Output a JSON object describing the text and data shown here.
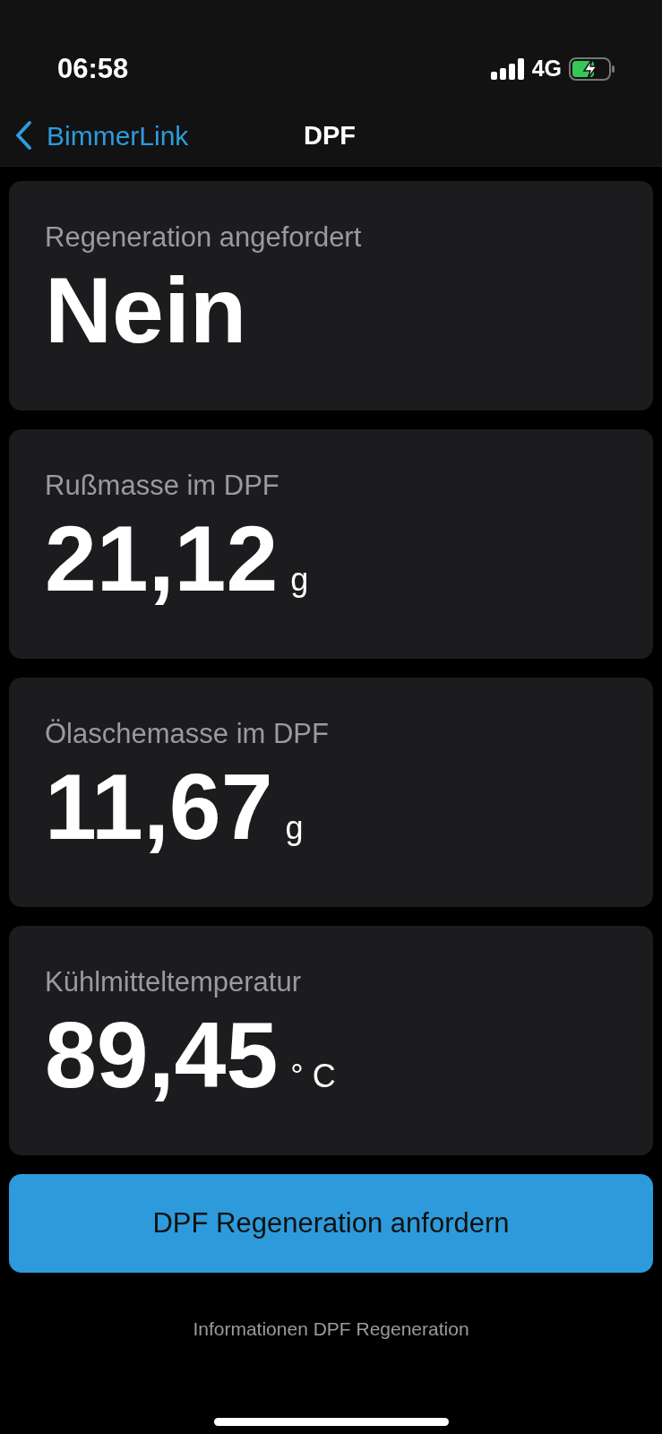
{
  "status_bar": {
    "time": "06:58",
    "network": "4G"
  },
  "nav": {
    "back_label": "BimmerLink",
    "title": "DPF"
  },
  "cards": [
    {
      "label": "Regeneration angefordert",
      "value": "Nein"
    },
    {
      "label": "Rußmasse im DPF",
      "value": "21,12",
      "unit": "g"
    },
    {
      "label": "Ölaschemasse im DPF",
      "value": "11,67",
      "unit": "g"
    },
    {
      "label": "Kühlmitteltemperatur",
      "value": "89,45",
      "unit": "° C"
    }
  ],
  "action_button": "DPF Regeneration anfordern",
  "info_link": "Informationen DPF Regeneration"
}
